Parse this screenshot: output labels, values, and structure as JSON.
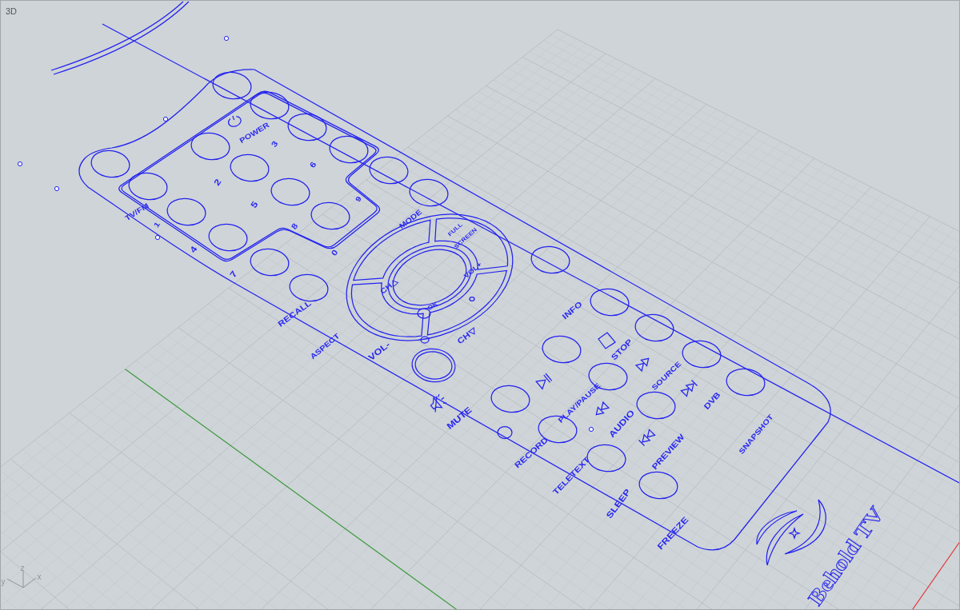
{
  "viewport": {
    "title": "3D",
    "axes": [
      "x",
      "y",
      "z"
    ]
  },
  "remote": {
    "labels": [
      "POWER",
      "TV/FM",
      "1",
      "2",
      "3",
      "4",
      "5",
      "6",
      "7",
      "8",
      "9",
      "0",
      "MODE",
      "FULL",
      "SCREEN",
      "CH△",
      "VOL+",
      "OK",
      "CH▽",
      "VOL-",
      "RECALL",
      "ASPECT",
      "INFO",
      "STOP",
      "MUTE",
      "PLAY/PAUSE",
      "SOURCE",
      "DVB",
      "RECORD",
      "AUDIO",
      "TELETEXT",
      "PREVIEW",
      "SLEEP",
      "FREEZE",
      "SNAPSHOT"
    ],
    "brand": "Behold TV"
  }
}
